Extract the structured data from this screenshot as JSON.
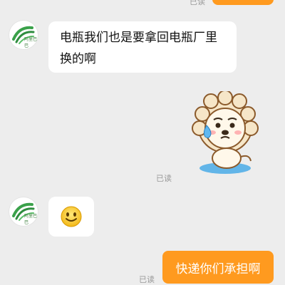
{
  "messages": {
    "top_read_receipt": "已读",
    "incoming_text": "电瓶我们也是要拿回电瓶厂里换的啊",
    "sticker_read_receipt": "已读",
    "outgoing_text": "快递你们承担啊",
    "outgoing_read_receipt": "已读"
  },
  "contact": {
    "avatar_text": "阿里巴巴"
  },
  "colors": {
    "background": "#ededed",
    "outgoing_bubble": "#ff9a1f",
    "incoming_bubble": "#ffffff"
  },
  "icons": {
    "sticker": "crying-lion-sticker",
    "emoji": "smiley-face-emoji"
  }
}
